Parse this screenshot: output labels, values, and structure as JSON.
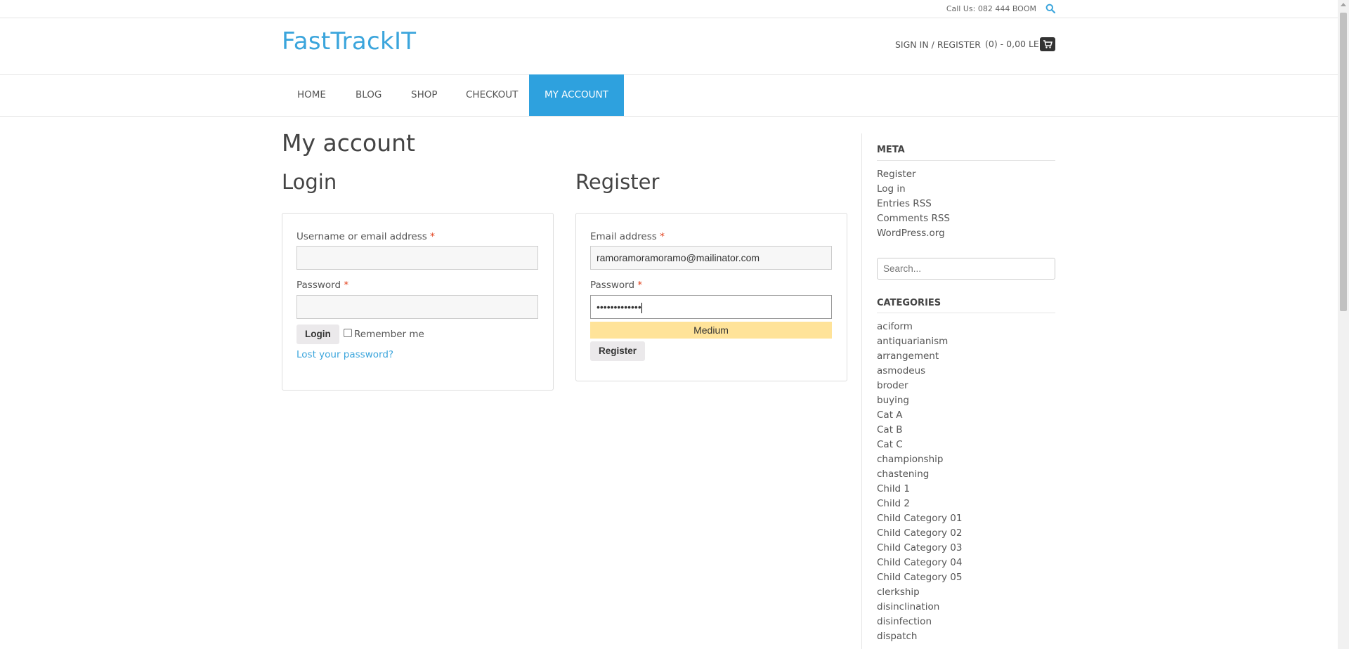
{
  "topbar": {
    "call": "Call Us: 082 444 BOOM",
    "search_icon": "search-icon"
  },
  "header": {
    "logo": "FastTrackIT",
    "signin": "SIGN IN / REGISTER",
    "cart": "(0) - 0,00 LEI",
    "cart_icon": "cart-icon"
  },
  "nav": {
    "items": [
      "HOME",
      "BLOG",
      "SHOP",
      "CHECKOUT",
      "MY ACCOUNT"
    ],
    "active": "MY ACCOUNT"
  },
  "main": {
    "title": "My account",
    "login": {
      "title": "Login",
      "username_label": "Username or email address",
      "username_value": "",
      "password_label": "Password",
      "password_value": "",
      "required_mark": "*",
      "login_button": "Login",
      "remember_label": "Remember me",
      "lost_password": "Lost your password?"
    },
    "register": {
      "title": "Register",
      "email_label": "Email address",
      "email_value": "ramoramoramoramo@mailinator.com",
      "password_label": "Password",
      "password_value": "•••••••••••••",
      "strength": "Medium",
      "register_button": "Register"
    }
  },
  "sidebar": {
    "meta_title": "META",
    "meta_links": [
      "Register",
      "Log in",
      "Entries RSS",
      "Comments RSS",
      "WordPress.org"
    ],
    "search_placeholder": "Search...",
    "categories_title": "CATEGORIES",
    "categories": [
      "aciform",
      "antiquarianism",
      "arrangement",
      "asmodeus",
      "broder",
      "buying",
      "Cat A",
      "Cat B",
      "Cat C",
      "championship",
      "chastening",
      "Child 1",
      "Child 2",
      "Child Category 01",
      "Child Category 02",
      "Child Category 03",
      "Child Category 04",
      "Child Category 05",
      "clerkship",
      "disinclination",
      "disinfection",
      "dispatch"
    ]
  },
  "colors": {
    "accent": "#2ea1de",
    "logo": "#3ba5dc",
    "strength_medium": "#ffe399"
  }
}
